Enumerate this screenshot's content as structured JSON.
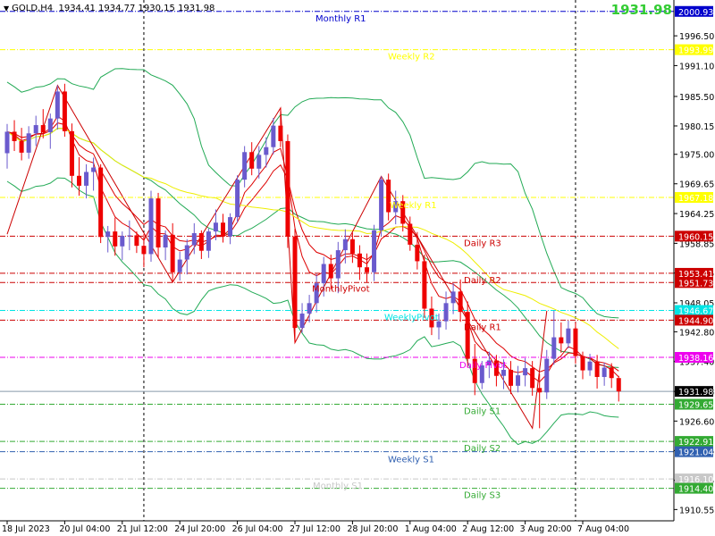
{
  "header": {
    "symbol_tf": "GOLD,H4",
    "ohlc": "1934.41 1934.77 1930.15 1931.98",
    "big_price": "1931.98",
    "big_price_color": "#33cc33"
  },
  "chart_data": {
    "type": "candlestick",
    "symbol": "GOLD",
    "timeframe": "H4",
    "ylim": [
      1908.5,
      2003
    ],
    "y_ticks": [
      1996.5,
      1991.1,
      1985.5,
      1980.15,
      1975.0,
      1969.65,
      1964.25,
      1958.85,
      1953.45,
      1948.05,
      1942.8,
      1937.4,
      1931.98,
      1926.6,
      1921.25,
      1915.85,
      1910.55
    ],
    "x_tick_labels": [
      "18 Jul 2023",
      "20 Jul 04:00",
      "21 Jul 12:00",
      "24 Jul 20:00",
      "26 Jul 04:00",
      "27 Jul 12:00",
      "28 Jul 20:00",
      "1 Aug 04:00",
      "2 Aug 12:00",
      "3 Aug 20:00",
      "7 Aug 04:00"
    ],
    "x_tick_bar_index": [
      0,
      8,
      16,
      24,
      32,
      40,
      48,
      56,
      64,
      72,
      80
    ],
    "candle_colors": {
      "up": "#6a5acd",
      "down": "#ee0000"
    },
    "candles": [
      [
        1975.2,
        1980.5,
        1972.4,
        1979.1
      ],
      [
        1979.1,
        1981.2,
        1975.6,
        1977.4
      ],
      [
        1977.4,
        1979.8,
        1973.9,
        1975.3
      ],
      [
        1975.3,
        1980.1,
        1974.2,
        1978.8
      ],
      [
        1978.8,
        1982.0,
        1976.5,
        1980.3
      ],
      [
        1980.3,
        1983.2,
        1977.9,
        1979.0
      ],
      [
        1979.0,
        1982.4,
        1976.0,
        1981.5
      ],
      [
        1981.5,
        1987.5,
        1979.5,
        1986.4
      ],
      [
        1986.4,
        1987.8,
        1978.2,
        1979.2
      ],
      [
        1979.2,
        1980.6,
        1969.0,
        1971.1
      ],
      [
        1971.1,
        1974.5,
        1967.5,
        1969.3
      ],
      [
        1969.3,
        1973.2,
        1967.0,
        1971.8
      ],
      [
        1971.8,
        1974.4,
        1968.4,
        1972.6
      ],
      [
        1972.6,
        1973.2,
        1958.9,
        1960.0
      ],
      [
        1960.0,
        1962.0,
        1957.2,
        1961.0
      ],
      [
        1961.0,
        1963.5,
        1956.6,
        1958.3
      ],
      [
        1958.3,
        1961.0,
        1955.8,
        1960.2
      ],
      [
        1960.2,
        1963.0,
        1957.6,
        1960.3
      ],
      [
        1960.3,
        1961.0,
        1957.1,
        1958.4
      ],
      [
        1958.4,
        1960.5,
        1954.5,
        1956.9
      ],
      [
        1956.9,
        1968.4,
        1955.5,
        1967.0
      ],
      [
        1967.0,
        1968.0,
        1956.3,
        1958.1
      ],
      [
        1958.1,
        1961.2,
        1955.8,
        1960.4
      ],
      [
        1960.4,
        1962.5,
        1951.8,
        1953.6
      ],
      [
        1953.6,
        1957.3,
        1952.1,
        1955.9
      ],
      [
        1955.9,
        1959.6,
        1953.2,
        1958.5
      ],
      [
        1958.5,
        1962.5,
        1956.9,
        1960.7
      ],
      [
        1960.7,
        1961.2,
        1956.0,
        1957.5
      ],
      [
        1957.5,
        1961.5,
        1956.2,
        1961.0
      ],
      [
        1961.0,
        1965.0,
        1959.4,
        1962.6
      ],
      [
        1962.6,
        1964.2,
        1959.0,
        1960.1
      ],
      [
        1960.1,
        1964.3,
        1958.7,
        1963.6
      ],
      [
        1963.6,
        1971.2,
        1962.6,
        1970.4
      ],
      [
        1970.4,
        1976.5,
        1969.0,
        1975.4
      ],
      [
        1975.4,
        1977.2,
        1971.2,
        1972.4
      ],
      [
        1972.4,
        1976.5,
        1970.6,
        1974.9
      ],
      [
        1974.9,
        1978.1,
        1972.6,
        1976.3
      ],
      [
        1976.3,
        1981.6,
        1975.0,
        1980.2
      ],
      [
        1980.2,
        1983.4,
        1976.3,
        1977.4
      ],
      [
        1977.4,
        1978.6,
        1958.0,
        1960.1
      ],
      [
        1960.1,
        1961.5,
        1940.8,
        1943.5
      ],
      [
        1943.5,
        1948.0,
        1942.6,
        1946.1
      ],
      [
        1946.1,
        1949.5,
        1944.5,
        1948.0
      ],
      [
        1948.0,
        1953.3,
        1946.3,
        1951.6
      ],
      [
        1951.6,
        1956.4,
        1949.2,
        1955.1
      ],
      [
        1955.1,
        1956.8,
        1950.5,
        1952.5
      ],
      [
        1952.5,
        1959.1,
        1949.8,
        1957.6
      ],
      [
        1957.6,
        1961.4,
        1955.2,
        1959.6
      ],
      [
        1959.6,
        1960.8,
        1955.3,
        1957.0
      ],
      [
        1957.0,
        1958.5,
        1952.2,
        1954.5
      ],
      [
        1954.5,
        1957.0,
        1951.8,
        1953.6
      ],
      [
        1953.6,
        1962.2,
        1952.0,
        1961.2
      ],
      [
        1961.2,
        1971.0,
        1960.1,
        1970.4
      ],
      [
        1970.4,
        1971.5,
        1963.0,
        1964.5
      ],
      [
        1964.5,
        1968.4,
        1962.3,
        1966.5
      ],
      [
        1966.5,
        1967.6,
        1961.0,
        1962.4
      ],
      [
        1962.4,
        1963.7,
        1957.5,
        1958.6
      ],
      [
        1958.6,
        1960.9,
        1954.1,
        1955.6
      ],
      [
        1955.6,
        1956.8,
        1945.3,
        1947.0
      ],
      [
        1947.0,
        1949.2,
        1942.2,
        1943.6
      ],
      [
        1943.6,
        1946.1,
        1941.4,
        1944.7
      ],
      [
        1944.7,
        1950.1,
        1943.2,
        1948.0
      ],
      [
        1948.0,
        1951.6,
        1946.0,
        1950.1
      ],
      [
        1950.1,
        1952.3,
        1944.6,
        1946.4
      ],
      [
        1946.4,
        1948.3,
        1936.4,
        1937.9
      ],
      [
        1937.9,
        1940.6,
        1931.3,
        1933.5
      ],
      [
        1933.5,
        1937.5,
        1932.4,
        1936.7
      ],
      [
        1936.7,
        1939.2,
        1934.4,
        1937.6
      ],
      [
        1937.6,
        1938.6,
        1932.9,
        1934.8
      ],
      [
        1934.8,
        1937.8,
        1932.4,
        1935.9
      ],
      [
        1935.9,
        1937.5,
        1931.5,
        1933.0
      ],
      [
        1933.0,
        1936.6,
        1931.8,
        1934.9
      ],
      [
        1934.9,
        1938.0,
        1932.9,
        1936.2
      ],
      [
        1936.2,
        1937.5,
        1931.2,
        1932.6
      ],
      [
        1932.6,
        1935.2,
        1925.3,
        1931.8
      ],
      [
        1931.8,
        1939.5,
        1930.6,
        1937.9
      ],
      [
        1937.9,
        1946.6,
        1936.8,
        1941.8
      ],
      [
        1941.8,
        1944.5,
        1939.0,
        1940.7
      ],
      [
        1940.7,
        1944.8,
        1939.8,
        1943.4
      ],
      [
        1943.4,
        1944.6,
        1937.0,
        1938.4
      ],
      [
        1938.4,
        1939.2,
        1934.2,
        1935.8
      ],
      [
        1935.8,
        1938.8,
        1934.8,
        1937.4
      ],
      [
        1937.4,
        1938.6,
        1932.5,
        1934.6
      ],
      [
        1934.6,
        1937.2,
        1933.0,
        1936.3
      ],
      [
        1936.3,
        1937.1,
        1932.6,
        1934.4
      ],
      [
        1934.4,
        1934.8,
        1930.15,
        1931.98
      ]
    ],
    "levels": [
      {
        "name": "Monthly R1",
        "price": 2000.93,
        "axis_label": "2000.93",
        "color": "#0000cc",
        "style": "dashdot"
      },
      {
        "name": "Weekly R2",
        "price": 1993.99,
        "axis_label": "1993.99",
        "color": "#ffff00",
        "style": "dashdot"
      },
      {
        "name": "Weekly R1",
        "price": 1967.18,
        "axis_label": "1967.18",
        "color": "#ffff00",
        "style": "dashdot"
      },
      {
        "name": "Daily R3",
        "price": 1960.15,
        "axis_label": "1960.15",
        "color": "#cc0000",
        "style": "dashdot"
      },
      {
        "name": "Daily R2",
        "price": 1953.41,
        "axis_label": "1953.41",
        "color": "#cc0000",
        "style": "dashdot"
      },
      {
        "name": "MonthlyPivot",
        "price": 1951.73,
        "axis_label": "1951.73",
        "color": "#cc0000",
        "style": "dashdot"
      },
      {
        "name": "WeeklyPivot",
        "price": 1946.67,
        "axis_label": "1946.67",
        "color": "#00e5e5",
        "style": "dashdot"
      },
      {
        "name": "Daily R1",
        "price": 1944.9,
        "axis_label": "1944.90",
        "color": "#cc0000",
        "style": "dashdot"
      },
      {
        "name": "Daily Pivot",
        "price": 1938.16,
        "axis_label": "1938.16",
        "color": "#ee00ee",
        "style": "dashdot"
      },
      {
        "name": "Daily S1",
        "price": 1929.65,
        "axis_label": "1929.65",
        "color": "#33aa33",
        "style": "dashdot"
      },
      {
        "name": "Daily S2",
        "price": 1922.91,
        "axis_label": "1922.91",
        "color": "#33aa33",
        "style": "dashdot"
      },
      {
        "name": "Weekly S1",
        "price": 1921.04,
        "axis_label": "1921.04",
        "color": "#3060b0",
        "style": "dashdot"
      },
      {
        "name": "Monthly S1",
        "price": 1916.1,
        "axis_label": "1916.10",
        "color": "#c8c8c8",
        "style": "dashdot"
      },
      {
        "name": "Daily S3",
        "price": 1914.4,
        "axis_label": "1914.40",
        "color": "#33aa33",
        "style": "dashdot"
      }
    ],
    "current_price": {
      "price": 1931.98,
      "axis_label": "1931.98"
    },
    "zigzag_points": [
      [
        0,
        1960.5
      ],
      [
        7,
        1987.5
      ],
      [
        23,
        1951.8
      ],
      [
        38,
        1983.4
      ],
      [
        40,
        1940.8
      ],
      [
        52,
        1971.0
      ],
      [
        73,
        1925.3
      ],
      [
        75,
        1946.6
      ]
    ],
    "indicator_colors": {
      "bollinger": "#22aa55",
      "ma_fast": "#dd0000",
      "ma_slow": "#eeee00",
      "zigzag": "#cc0000"
    }
  }
}
